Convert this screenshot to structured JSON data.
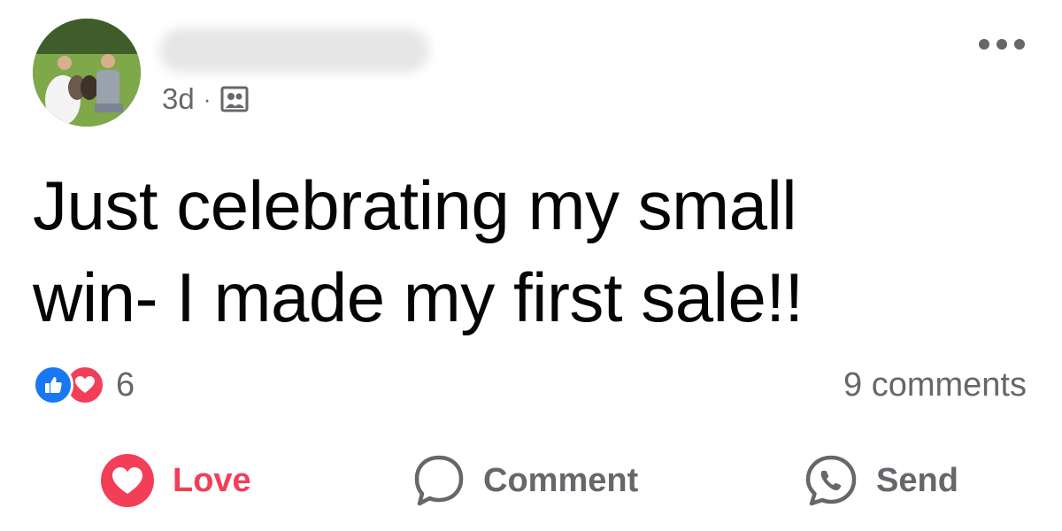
{
  "post": {
    "time": "3d",
    "separator": "·",
    "audience_icon": "group-photo-icon",
    "text_line1": "Just celebrating my small",
    "text_line2": "win- I made my first sale!!",
    "reaction_count": "6",
    "comments_label": "9 comments"
  },
  "actions": {
    "love_label": "Love",
    "comment_label": "Comment",
    "send_label": "Send"
  },
  "colors": {
    "love_red": "#f33e58",
    "like_blue": "#1877f2",
    "meta_gray": "#65676b",
    "text_black": "#050505"
  },
  "icons": {
    "more": "more-dots-icon",
    "like": "thumbs-up-icon",
    "love": "heart-icon",
    "comment": "speech-bubble-icon",
    "send": "messenger-icon"
  }
}
